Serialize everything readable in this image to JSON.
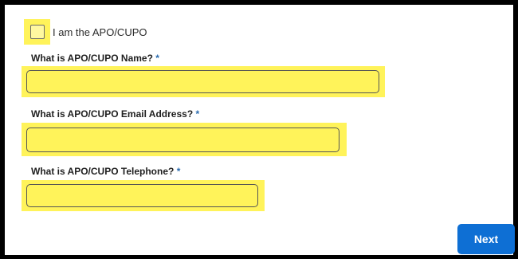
{
  "checkbox": {
    "label": "I am the APO/CUPO",
    "checked": false
  },
  "fields": [
    {
      "label": "What is APO/CUPO Name?",
      "required_mark": "*",
      "value": ""
    },
    {
      "label": "What is APO/CUPO Email Address?",
      "required_mark": "*",
      "value": ""
    },
    {
      "label": "What is APO/CUPO Telephone?",
      "required_mark": "*",
      "value": ""
    }
  ],
  "actions": {
    "next_label": "Next"
  },
  "colors": {
    "highlight": "#fff35a",
    "accent": "#0e6fd4",
    "required": "#2b6cb0"
  }
}
